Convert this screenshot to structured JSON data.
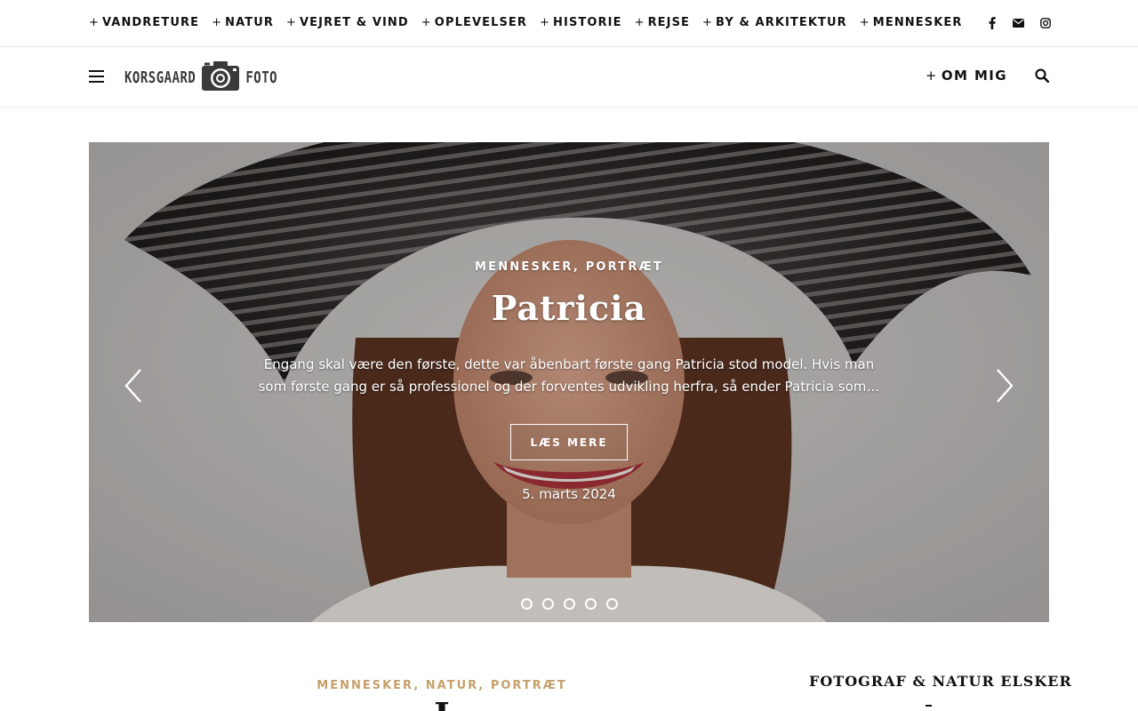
{
  "top_nav": {
    "items": [
      {
        "plus": "+",
        "label": "VANDRETURE"
      },
      {
        "plus": "+",
        "label": "NATUR"
      },
      {
        "plus": "+",
        "label": "VEJRET & VIND"
      },
      {
        "plus": "+",
        "label": "OPLEVELSER"
      },
      {
        "plus": "+",
        "label": "HISTORIE"
      },
      {
        "plus": "+",
        "label": "REJSE"
      },
      {
        "plus": "+",
        "label": "BY & ARKITEKTUR"
      },
      {
        "plus": "+",
        "label": "MENNESKER"
      }
    ],
    "social_icons": [
      "facebook-icon",
      "envelope-icon",
      "instagram-icon"
    ]
  },
  "header": {
    "logo": {
      "left": "KORSGAARD",
      "right": "FOTO"
    },
    "about": {
      "plus": "+",
      "label": "OM MIG"
    }
  },
  "hero": {
    "categories": "MENNESKER, PORTRÆT",
    "title": "Patricia",
    "excerpt": "Engang skal være den første, dette var åbenbart første gang Patricia stod model. Hvis man som første gang er så professionel og der forventes udvikling herfra, så ender Patricia som…",
    "read_more": "LÆS MERE",
    "date": "5. marts 2024",
    "slide_count": 5,
    "active_slide": 1
  },
  "post": {
    "categories": "MENNESKER, NATUR, PORTRÆT",
    "title_partial": "I"
  },
  "sidebar": {
    "widget_title": "FOTOGRAF & NATUR ELSKER"
  },
  "colors": {
    "accent": "#c5a06b",
    "text": "#111111",
    "white": "#ffffff"
  }
}
